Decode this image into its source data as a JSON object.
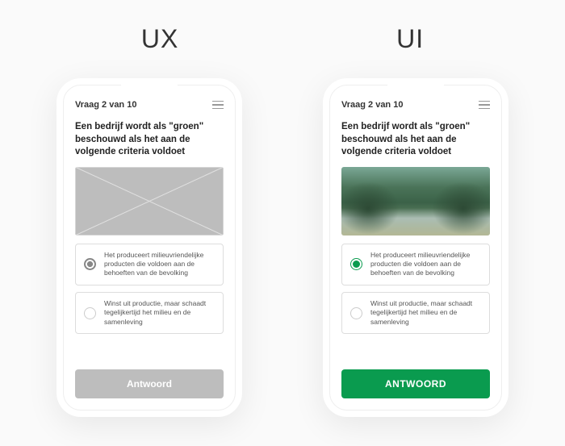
{
  "labels": {
    "ux": "UX",
    "ui": "UI"
  },
  "ux": {
    "progress": "Vraag 2 van 10",
    "question": "Een bedrijf wordt als \"groen\" beschouwd als het aan de volgende criteria voldoet",
    "options": [
      {
        "text": "Het produceert milieuvriendelijke producten die voldoen aan de behoeften van de bevolking",
        "selected": true
      },
      {
        "text": "Winst uit productie, maar schaadt tegelijkertijd het milieu en de samenleving",
        "selected": false
      }
    ],
    "button": "Antwoord"
  },
  "ui": {
    "progress": "Vraag 2 van 10",
    "question": "Een bedrijf wordt als \"groen\" beschouwd als het aan de volgende criteria voldoet",
    "options": [
      {
        "text": "Het produceert milieuvriendelijke producten die voldoen aan de behoeften van de bevolking",
        "selected": true
      },
      {
        "text": "Winst uit productie, maar schaadt tegelijkertijd het milieu en de samenleving",
        "selected": false
      }
    ],
    "button": "ANTWOORD",
    "accent": "#0a9b4f"
  }
}
